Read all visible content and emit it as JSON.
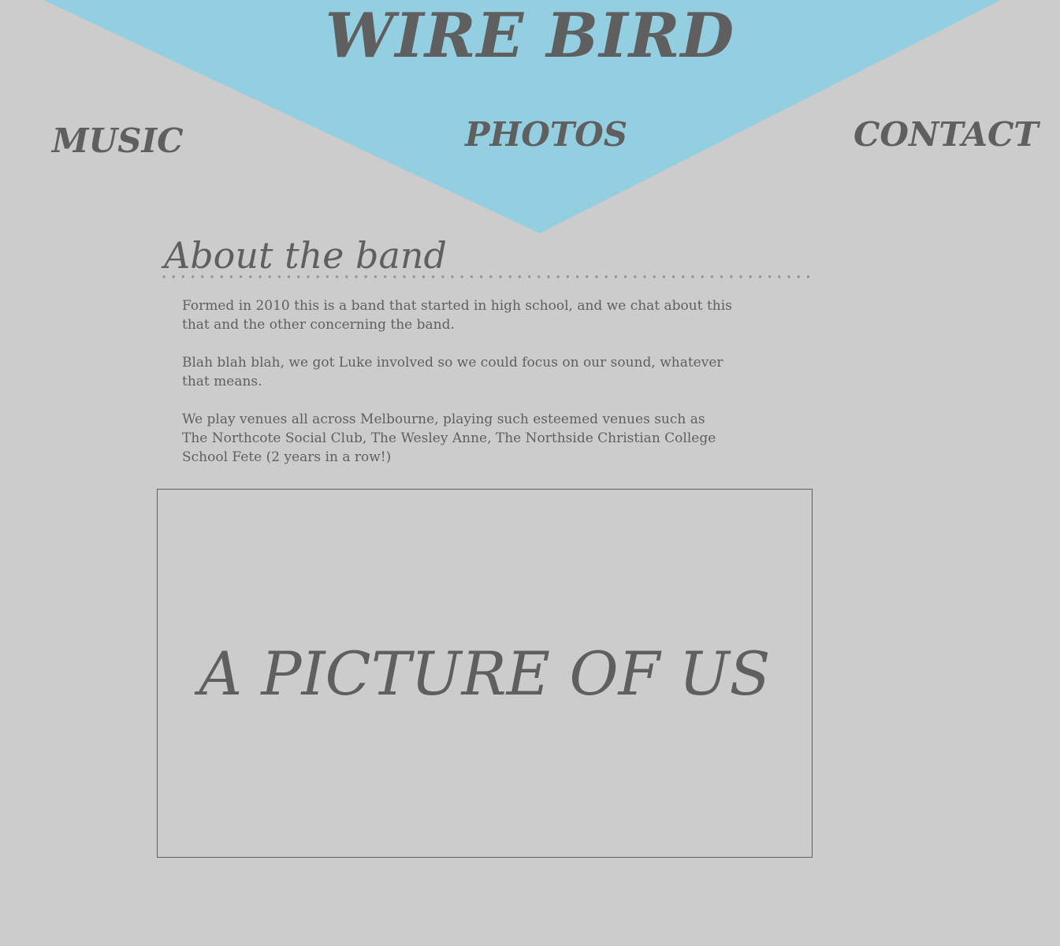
{
  "colors": {
    "background": "#cccccc",
    "banner": "#93cfe0",
    "text": "#5f5f5f"
  },
  "header": {
    "site_title": "WIRE BIRD"
  },
  "nav": {
    "music": "MUSIC",
    "photos": "PHOTOS",
    "contact": "CONTACT"
  },
  "about": {
    "heading": "About the band",
    "paragraphs": [
      "Formed in 2010 this is a band that started in high school, and we chat about this that and the other concerning the band.",
      "Blah blah blah, we got Luke involved so we could focus on our sound, whatever that means.",
      "We play venues all across Melbourne, playing such esteemed venues such as  The Northcote Social Club, The Wesley Anne, The Northside Christian College School Fete (2 years in a row!)"
    ]
  },
  "picture": {
    "placeholder_label": "A PICTURE OF US"
  }
}
